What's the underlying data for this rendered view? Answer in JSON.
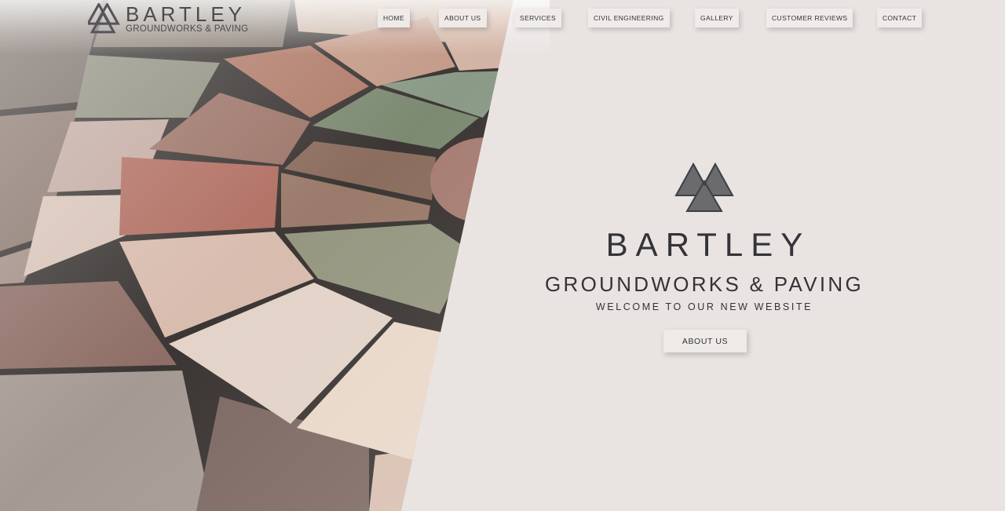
{
  "header": {
    "brand": "BARTLEY",
    "tagline": "GROUNDWORKS & PAVING"
  },
  "nav": {
    "items": [
      {
        "label": "HOME"
      },
      {
        "label": "ABOUT US"
      },
      {
        "label": "SERVICES"
      },
      {
        "label": "CIVIL ENGINEERING"
      },
      {
        "label": "GALLERY"
      },
      {
        "label": "CUSTOMER REVIEWS"
      },
      {
        "label": "CONTACT"
      }
    ]
  },
  "hero": {
    "title": "BARTLEY",
    "subtitle": "GROUNDWORKS & PAVING",
    "welcome": "WELCOME TO OUR NEW WEBSITE",
    "cta_label": "ABOUT US",
    "image_subject": "circular natural stone paving"
  },
  "colors": {
    "background": "#e9e4e2",
    "text": "#333338",
    "logo_grey": "#6f6f71"
  },
  "icons": {
    "logo": "triangle-knot-logo-icon"
  }
}
